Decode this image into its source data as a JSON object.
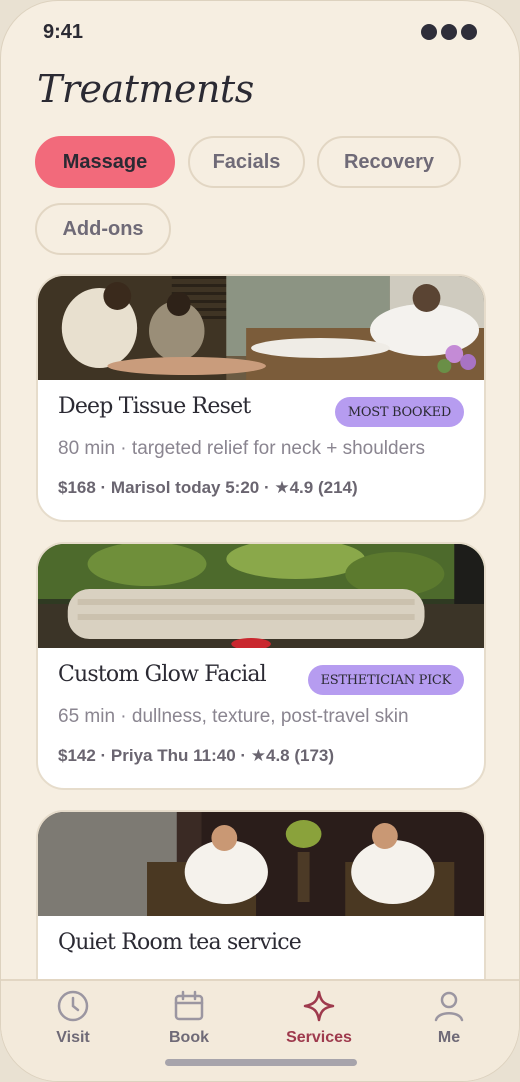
{
  "status": {
    "time": "9:41"
  },
  "page": {
    "title": "Treatments"
  },
  "filters": [
    {
      "label": "Massage",
      "active": true
    },
    {
      "label": "Facials",
      "active": false
    },
    {
      "label": "Recovery",
      "active": false
    },
    {
      "label": "Add-ons",
      "active": false
    }
  ],
  "cards": [
    {
      "title": "Deep Tissue Reset",
      "badge": "MOST BOOKED",
      "description": "80 min · targeted relief for neck + shoulders",
      "meta": "$168 · Marisol today 5:20 · ★4.9 (214)"
    },
    {
      "title": "Custom Glow Facial",
      "badge": "ESTHETICIAN PICK",
      "description": "65 min · dullness, texture, post-travel skin",
      "meta": "$142 · Priya Thu 11:40 · ★4.8 (173)"
    },
    {
      "title": "Quiet Room tea service"
    }
  ],
  "tabs": [
    {
      "label": "Visit",
      "icon": "clock-icon"
    },
    {
      "label": "Book",
      "icon": "calendar-icon"
    },
    {
      "label": "Services",
      "icon": "sparkle-icon",
      "active": true
    },
    {
      "label": "Me",
      "icon": "person-icon"
    }
  ],
  "colors": {
    "background": "#f6eee1",
    "accent": "#f26a7b",
    "badge": "#b69cf0",
    "active_tab": "#9e3a4d"
  }
}
